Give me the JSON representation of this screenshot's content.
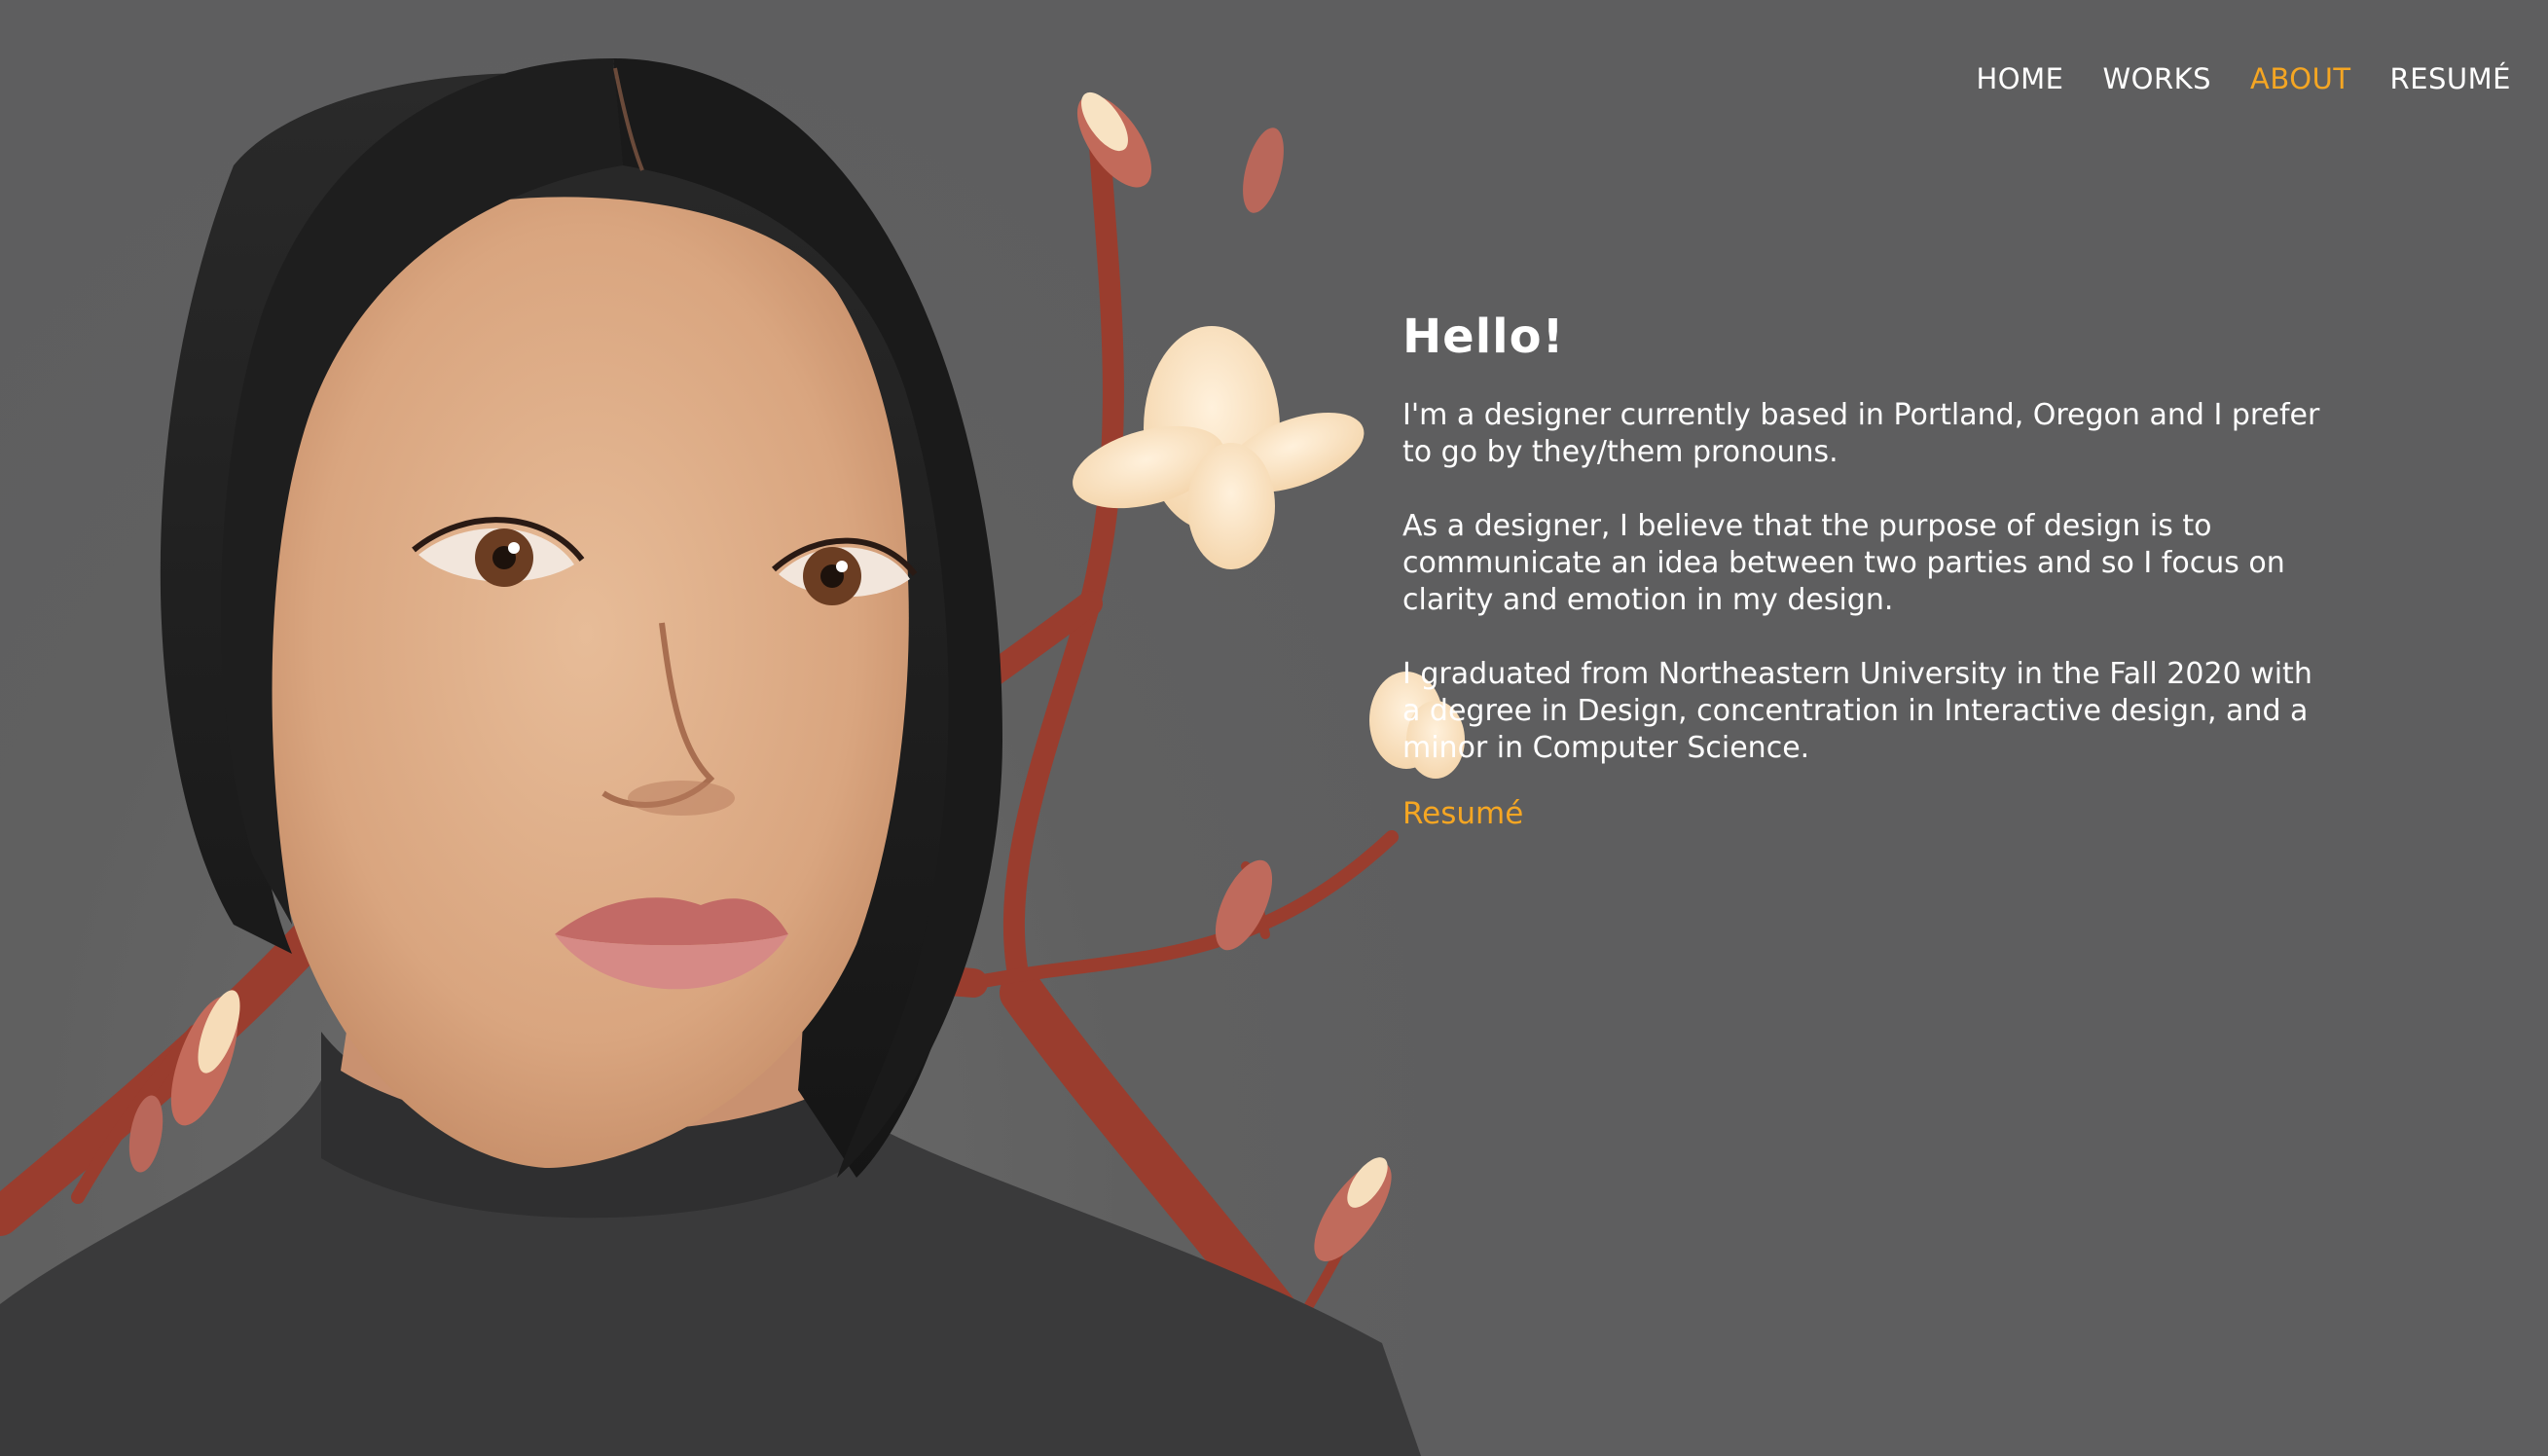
{
  "nav": {
    "items": [
      {
        "label": "HOME",
        "active": false
      },
      {
        "label": "WORKS",
        "active": false
      },
      {
        "label": "ABOUT",
        "active": true
      },
      {
        "label": "RESUMÉ",
        "active": false
      }
    ]
  },
  "about": {
    "heading": "Hello!",
    "paragraphs": [
      "I'm a designer currently based in Portland, Oregon and I prefer to go by they/them pronouns.",
      "As a designer, I believe that the purpose of design is to communicate an idea between two parties and so I focus on clarity and emotion in my design.",
      "I graduated from Northeastern University in the Fall 2020 with a degree in Design, concentration in Interactive design, and a minor in Computer Science."
    ],
    "resume_link": "Resumé"
  },
  "colors": {
    "background": "#5e5e5f",
    "accent": "#f5a623",
    "text": "#ffffff"
  }
}
